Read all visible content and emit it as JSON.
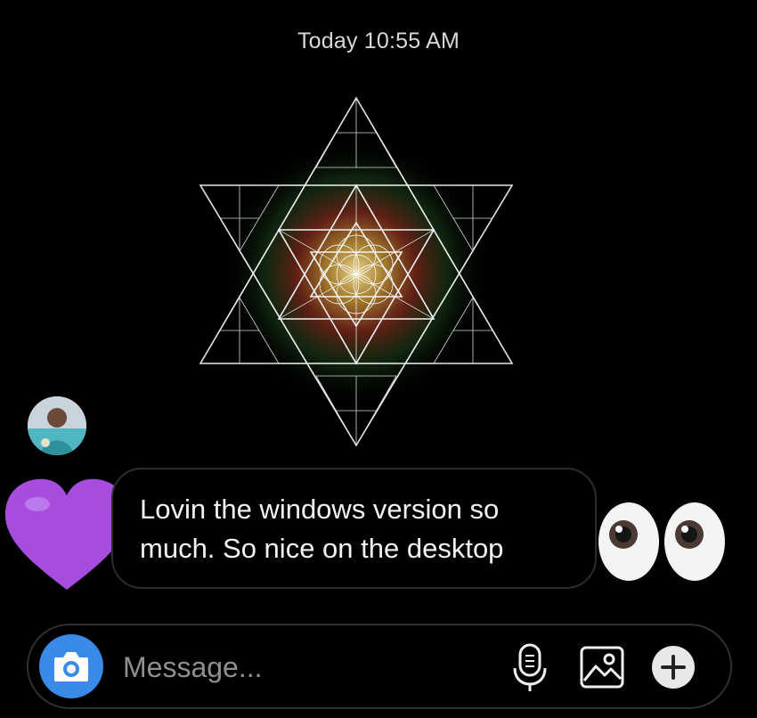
{
  "thread": {
    "timestamp": "Today 10:55 AM"
  },
  "message": {
    "text": "Lovin the windows version so much. So nice on the desktop",
    "reaction_emoji": "purple-heart",
    "trailing_emoji": "eyes"
  },
  "composer": {
    "placeholder": "Message..."
  },
  "icons": {
    "camera": "camera-icon",
    "microphone": "microphone-icon",
    "gallery": "gallery-icon",
    "plus": "plus-icon"
  },
  "colors": {
    "background": "#000000",
    "camera_button": "#3a8be7",
    "heart": "#a64de0",
    "timestamp_text": "#d8d8d8",
    "placeholder_text": "#8f8f8f"
  }
}
